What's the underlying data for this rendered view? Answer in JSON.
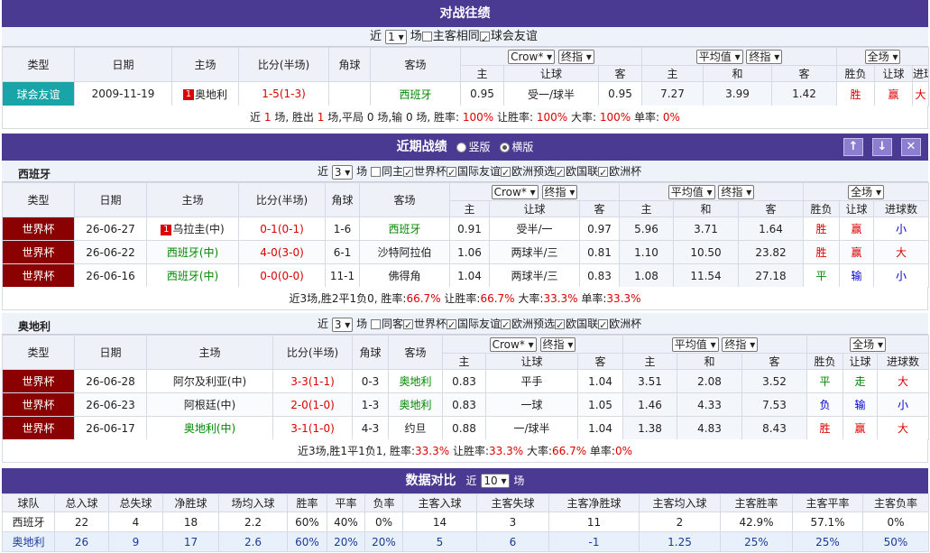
{
  "h2h": {
    "title": "对战往绩",
    "near": "近",
    "count": "1",
    "unit": "场",
    "host_same": "主客相同",
    "friendly": "球会友谊",
    "headers": {
      "type": "类型",
      "date": "日期",
      "home": "主场",
      "score": "比分(半场)",
      "corner": "角球",
      "away": "客场",
      "crow": "Crow*",
      "final1": "终指",
      "avg": "平均值",
      "final2": "终指",
      "full": "全场",
      "h": "主",
      "line": "让球",
      "a": "客",
      "h2": "主",
      "d": "和",
      "a2": "客",
      "wl": "胜负",
      "hl": "让球",
      "ou": "进球数"
    },
    "rows": [
      {
        "type": "球会友谊",
        "date": "2009-11-19",
        "home_rank": "1",
        "home": "奥地利",
        "score": "1-5(1-3)",
        "corner": "",
        "away": "西班牙",
        "o1": "0.95",
        "line": "受一/球半",
        "o2": "0.95",
        "e1": "7.27",
        "e2": "3.99",
        "e3": "1.42",
        "wl": "胜",
        "hl": "赢",
        "ou": "大"
      }
    ],
    "summary": {
      "t1": "近 ",
      "n1": "1",
      "t2": " 场, 胜出 ",
      "n2": "1",
      "t3": " 场,平局 0 场,输 0 场, 胜率: ",
      "r1": "100%",
      "t4": " 让胜率: ",
      "r2": "100%",
      "t5": " 大率: ",
      "r3": "100%",
      "t6": " 单率: ",
      "r4": "0%"
    }
  },
  "recent": {
    "title": "近期战绩",
    "vertical": "竖版",
    "horizontal": "横版",
    "up": "↑",
    "down": "↓",
    "close": "✕"
  },
  "spain": {
    "team": "西班牙",
    "near": "近",
    "count": "3",
    "unit": "场",
    "same": "同主",
    "filters": [
      "世界杯",
      "国际友谊",
      "欧洲预选",
      "欧国联",
      "欧洲杯"
    ],
    "rows": [
      {
        "type": "世界杯",
        "date": "26-06-27",
        "home_rank": "1",
        "home": "乌拉圭(中)",
        "score": "0-1(0-1)",
        "corner": "1-6",
        "away": "西班牙",
        "o1": "0.91",
        "line": "受半/一",
        "o2": "0.97",
        "e1": "5.96",
        "e2": "3.71",
        "e3": "1.64",
        "wl": "胜",
        "hl": "赢",
        "ou": "小"
      },
      {
        "type": "世界杯",
        "date": "26-06-22",
        "home_rank": "",
        "home": "西班牙(中)",
        "score": "4-0(3-0)",
        "corner": "6-1",
        "away": "沙特阿拉伯",
        "o1": "1.06",
        "line": "两球半/三",
        "o2": "0.81",
        "e1": "1.10",
        "e2": "10.50",
        "e3": "23.82",
        "wl": "胜",
        "hl": "赢",
        "ou": "大"
      },
      {
        "type": "世界杯",
        "date": "26-06-16",
        "home_rank": "",
        "home": "西班牙(中)",
        "score": "0-0(0-0)",
        "corner": "11-1",
        "away": "佛得角",
        "o1": "1.04",
        "line": "两球半/三",
        "o2": "0.83",
        "e1": "1.08",
        "e2": "11.54",
        "e3": "27.18",
        "wl": "平",
        "hl": "输",
        "ou": "小"
      }
    ],
    "summary": {
      "t1": "近3场,胜2平1负0, 胜率:",
      "r1": "66.7%",
      "t2": " 让胜率:",
      "r2": "66.7%",
      "t3": " 大率:",
      "r3": "33.3%",
      "t4": " 单率:",
      "r4": "33.3%"
    }
  },
  "austria": {
    "team": "奥地利",
    "near": "近",
    "count": "3",
    "unit": "场",
    "same": "同客",
    "filters": [
      "世界杯",
      "国际友谊",
      "欧洲预选",
      "欧国联",
      "欧洲杯"
    ],
    "rows": [
      {
        "type": "世界杯",
        "date": "26-06-28",
        "home": "阿尔及利亚(中)",
        "score": "3-3(1-1)",
        "corner": "0-3",
        "away": "奥地利",
        "o1": "0.83",
        "line": "平手",
        "o2": "1.04",
        "e1": "3.51",
        "e2": "2.08",
        "e3": "3.52",
        "wl": "平",
        "hl": "走",
        "ou": "大"
      },
      {
        "type": "世界杯",
        "date": "26-06-23",
        "home": "阿根廷(中)",
        "score": "2-0(1-0)",
        "corner": "1-3",
        "away": "奥地利",
        "o1": "0.83",
        "line": "一球",
        "o2": "1.05",
        "e1": "1.46",
        "e2": "4.33",
        "e3": "7.53",
        "wl": "负",
        "hl": "输",
        "ou": "小"
      },
      {
        "type": "世界杯",
        "date": "26-06-17",
        "home": "奥地利(中)",
        "score": "3-1(1-0)",
        "corner": "4-3",
        "away": "约旦",
        "o1": "0.88",
        "line": "一/球半",
        "o2": "1.04",
        "e1": "1.38",
        "e2": "4.83",
        "e3": "8.43",
        "wl": "胜",
        "hl": "赢",
        "ou": "大"
      }
    ],
    "summary": {
      "t1": "近3场,胜1平1负1, 胜率:",
      "r1": "33.3%",
      "t2": " 让胜率:",
      "r2": "33.3%",
      "t3": " 大率:",
      "r3": "66.7%",
      "t4": " 单率:",
      "r4": "0%"
    }
  },
  "compare": {
    "title": "数据对比",
    "near": "近",
    "count": "10",
    "unit": "场",
    "headers": [
      "球队",
      "总入球",
      "总失球",
      "净胜球",
      "场均入球",
      "胜率",
      "平率",
      "负率",
      "主客入球",
      "主客失球",
      "主客净胜球",
      "主客均入球",
      "主客胜率",
      "主客平率",
      "主客负率"
    ],
    "rows": [
      [
        "西班牙",
        "22",
        "4",
        "18",
        "2.2",
        "60%",
        "40%",
        "0%",
        "14",
        "3",
        "11",
        "2",
        "42.9%",
        "57.1%",
        "0%"
      ],
      [
        "奥地利",
        "26",
        "9",
        "17",
        "2.6",
        "60%",
        "20%",
        "20%",
        "5",
        "6",
        "-1",
        "1.25",
        "25%",
        "25%",
        "50%"
      ]
    ]
  }
}
